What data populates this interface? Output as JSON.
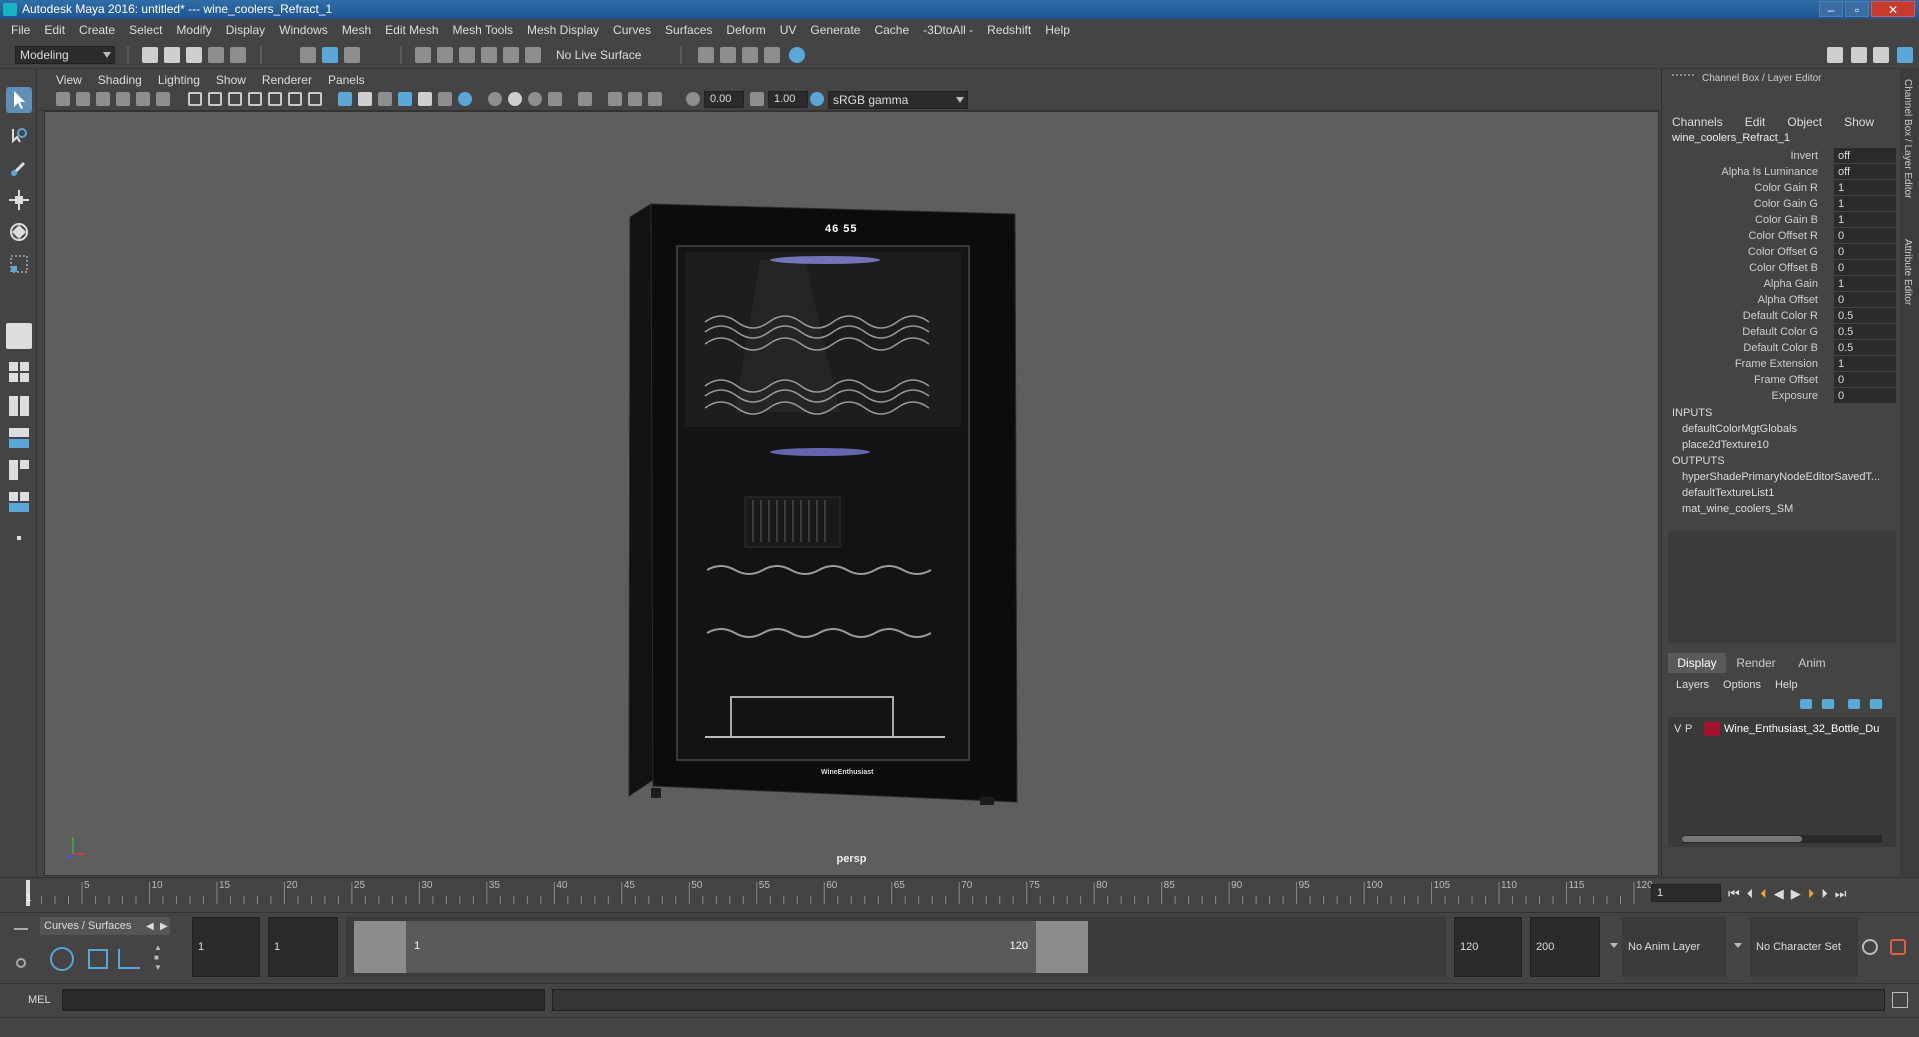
{
  "window": {
    "title": "Autodesk Maya 2016: untitled*   ---   wine_coolers_Refract_1"
  },
  "menubar": [
    "File",
    "Edit",
    "Create",
    "Select",
    "Modify",
    "Display",
    "Windows",
    "Mesh",
    "Edit Mesh",
    "Mesh Tools",
    "Mesh Display",
    "Curves",
    "Surfaces",
    "Deform",
    "UV",
    "Generate",
    "Cache",
    "-3DtoAll -",
    "Redshift",
    "Help"
  ],
  "statusline": {
    "mode": "Modeling",
    "live_surface": "No Live Surface"
  },
  "panel": {
    "menu": [
      "View",
      "Shading",
      "Lighting",
      "Show",
      "Renderer",
      "Panels"
    ],
    "exposure": "0.00",
    "gamma": "1.00",
    "colorspace": "sRGB gamma",
    "camera": "persp"
  },
  "product": {
    "display": "46 55",
    "brand": "WineEnthusiast"
  },
  "channelbox": {
    "header": "Channel Box / Layer Editor",
    "menu": [
      "Channels",
      "Edit",
      "Object",
      "Show"
    ],
    "node": "wine_coolers_Refract_1",
    "attrs": [
      {
        "label": "Invert",
        "value": "off"
      },
      {
        "label": "Alpha Is Luminance",
        "value": "off"
      },
      {
        "label": "Color Gain R",
        "value": "1"
      },
      {
        "label": "Color Gain G",
        "value": "1"
      },
      {
        "label": "Color Gain B",
        "value": "1"
      },
      {
        "label": "Color Offset R",
        "value": "0"
      },
      {
        "label": "Color Offset G",
        "value": "0"
      },
      {
        "label": "Color Offset B",
        "value": "0"
      },
      {
        "label": "Alpha Gain",
        "value": "1"
      },
      {
        "label": "Alpha Offset",
        "value": "0"
      },
      {
        "label": "Default Color R",
        "value": "0.5"
      },
      {
        "label": "Default Color G",
        "value": "0.5"
      },
      {
        "label": "Default Color B",
        "value": "0.5"
      },
      {
        "label": "Frame Extension",
        "value": "1"
      },
      {
        "label": "Frame Offset",
        "value": "0"
      },
      {
        "label": "Exposure",
        "value": "0"
      }
    ],
    "inputs_label": "INPUTS",
    "inputs": [
      "defaultColorMgtGlobals",
      "place2dTexture10"
    ],
    "outputs_label": "OUTPUTS",
    "outputs": [
      "hyperShadePrimaryNodeEditorSavedT...",
      "defaultTextureList1",
      "mat_wine_coolers_SM"
    ]
  },
  "layer_editor": {
    "tabs": [
      "Display",
      "Render",
      "Anim"
    ],
    "menu": [
      "Layers",
      "Options",
      "Help"
    ],
    "layer": {
      "v": "V",
      "p": "P",
      "name": "Wine_Enthusiast_32_Bottle_Du",
      "color": "#a0142e"
    }
  },
  "side_tabs": [
    "Channel Box / Layer Editor",
    "Attribute Editor"
  ],
  "timeline": {
    "ticks": [
      "5",
      "10",
      "15",
      "20",
      "25",
      "30",
      "35",
      "40",
      "45",
      "50",
      "55",
      "60",
      "65",
      "70",
      "75",
      "80",
      "85",
      "90",
      "95",
      "100",
      "105",
      "110",
      "115",
      "120"
    ],
    "start_label": "1",
    "current_frame": "1"
  },
  "range": {
    "shelf_tab": "Curves / Surfaces",
    "start": "1",
    "playback_start": "1",
    "slider_start": "1",
    "slider_end": "120",
    "playback_end": "120",
    "end": "200",
    "anim_layer": "No Anim Layer",
    "character_set": "No Character Set"
  },
  "cmd": {
    "label": "MEL"
  },
  "colors": {
    "selected_tool": "#5f8fb8",
    "titlebar": "#1f5590"
  }
}
